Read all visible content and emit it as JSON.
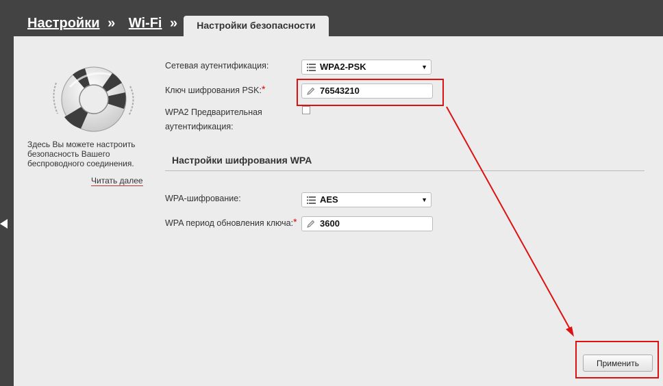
{
  "breadcrumb": {
    "item1": "Настройки",
    "item2": "Wi-Fi",
    "separator": "»"
  },
  "tab": {
    "label": "Настройки безопасности"
  },
  "sidebar": {
    "help_text": "Здесь Вы можете настроить безопасность Вашего беспроводного соединения.",
    "read_more": "Читать далее"
  },
  "form": {
    "network_auth": {
      "label": "Сетевая аутентификация:",
      "value": "WPA2-PSK"
    },
    "psk_key": {
      "label": "Ключ шифрования PSK:",
      "required_mark": "*",
      "value": "76543210"
    },
    "wpa2_preauth": {
      "label": "WPA2 Предварительная аутентификация:",
      "checked": false
    },
    "wpa_section_title": "Настройки шифрования WPA",
    "wpa_encryption": {
      "label": "WPA-шифрование:",
      "value": "AES"
    },
    "wpa_rekey": {
      "label": "WPA период обновления ключа:",
      "required_mark": "*",
      "value": "3600"
    }
  },
  "actions": {
    "apply": "Применить"
  },
  "colors": {
    "background": "#434343",
    "panel": "#ececec",
    "annotation": "#dd1111"
  },
  "icons": [
    "lifebuoy-icon",
    "list-icon",
    "pencil-icon",
    "dropdown-caret-icon",
    "back-arrow-icon"
  ]
}
